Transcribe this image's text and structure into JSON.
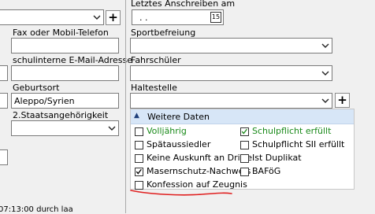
{
  "left_fields": {
    "fax_label": "Fax oder Mobil-Telefon",
    "email_label": "schulinterne E-Mail-Adresse",
    "birthplace_label": "Geburtsort",
    "birthplace_value": "Aleppo/Syrien",
    "citizenship2_label": "2.Staatsangehörigkeit",
    "plus_label": "+"
  },
  "right_fields": {
    "last_letter_label": "Letztes Anschreiben am",
    "last_letter_value": ". .",
    "calendar_day": "15",
    "sports_exemption_label": "Sportbefreiung",
    "commuter_label": "Fahrschüler",
    "bus_stop_label": "Haltestelle",
    "plus_label": "+"
  },
  "further_data": {
    "title": "Weitere Daten",
    "collapse_glyph": "▲",
    "checkboxes": [
      {
        "label": "Volljährig",
        "checked": false
      },
      {
        "label": "Spätaussiedler",
        "checked": false
      },
      {
        "label": "Keine Auskunft an Dritte",
        "checked": false
      },
      {
        "label": "Masernschutz-Nachweis",
        "checked": true
      },
      {
        "label": "Konfession auf Zeugnis",
        "checked": false
      },
      {
        "label": "Schulpflicht erfüllt",
        "checked": true
      },
      {
        "label": "Schulpflicht SII erfüllt",
        "checked": false
      },
      {
        "label": "Ist Duplikat",
        "checked": false
      },
      {
        "label": "BAFöG",
        "checked": false
      }
    ]
  },
  "footer_text": "07:13:00 durch laa",
  "colors": {
    "accent_green": "#1a8a1a",
    "red_underline": "#e02020",
    "panel_header": "#d7e6f7"
  }
}
